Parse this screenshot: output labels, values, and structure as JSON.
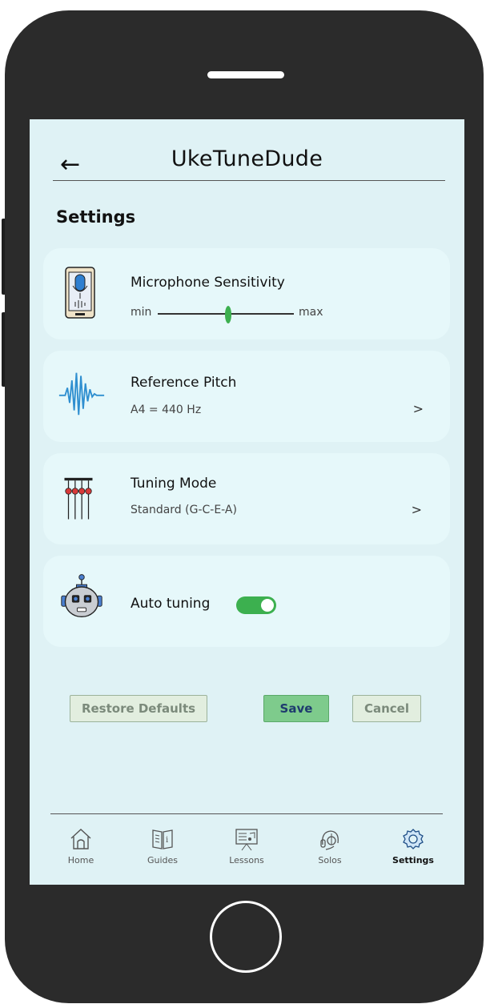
{
  "header": {
    "back_icon": "←",
    "app_title": "UkeTuneDude"
  },
  "page_title": "Settings",
  "cards": {
    "mic": {
      "title": "Microphone Sensitivity",
      "min_label": "min",
      "max_label": "max",
      "sensitivity_fraction": 0.52,
      "icon": "microphone-phone-icon"
    },
    "pitch": {
      "title": "Reference Pitch",
      "value": "A4 = 440 Hz",
      "chevron": ">",
      "icon": "waveform-icon"
    },
    "tuning": {
      "title": "Tuning Mode",
      "value": "Standard (G-C-E-A)",
      "chevron": ">",
      "icon": "ukulele-strings-icon"
    },
    "auto": {
      "title": "Auto tuning",
      "enabled": true,
      "icon": "robot-icon"
    }
  },
  "actions": {
    "restore": "Restore Defaults",
    "save": "Save",
    "cancel": "Cancel"
  },
  "nav": [
    {
      "label": "Home",
      "icon": "home-icon"
    },
    {
      "label": "Guides",
      "icon": "book-icon"
    },
    {
      "label": "Lessons",
      "icon": "whiteboard-icon"
    },
    {
      "label": "Solos",
      "icon": "headphones-icon"
    },
    {
      "label": "Settings",
      "icon": "gear-icon",
      "active": true
    }
  ],
  "colors": {
    "accent_green": "#3cb04f",
    "screen_bg": "#dff2f5",
    "card_bg": "#e6f8fa",
    "phone_body": "#2b2b2b"
  }
}
